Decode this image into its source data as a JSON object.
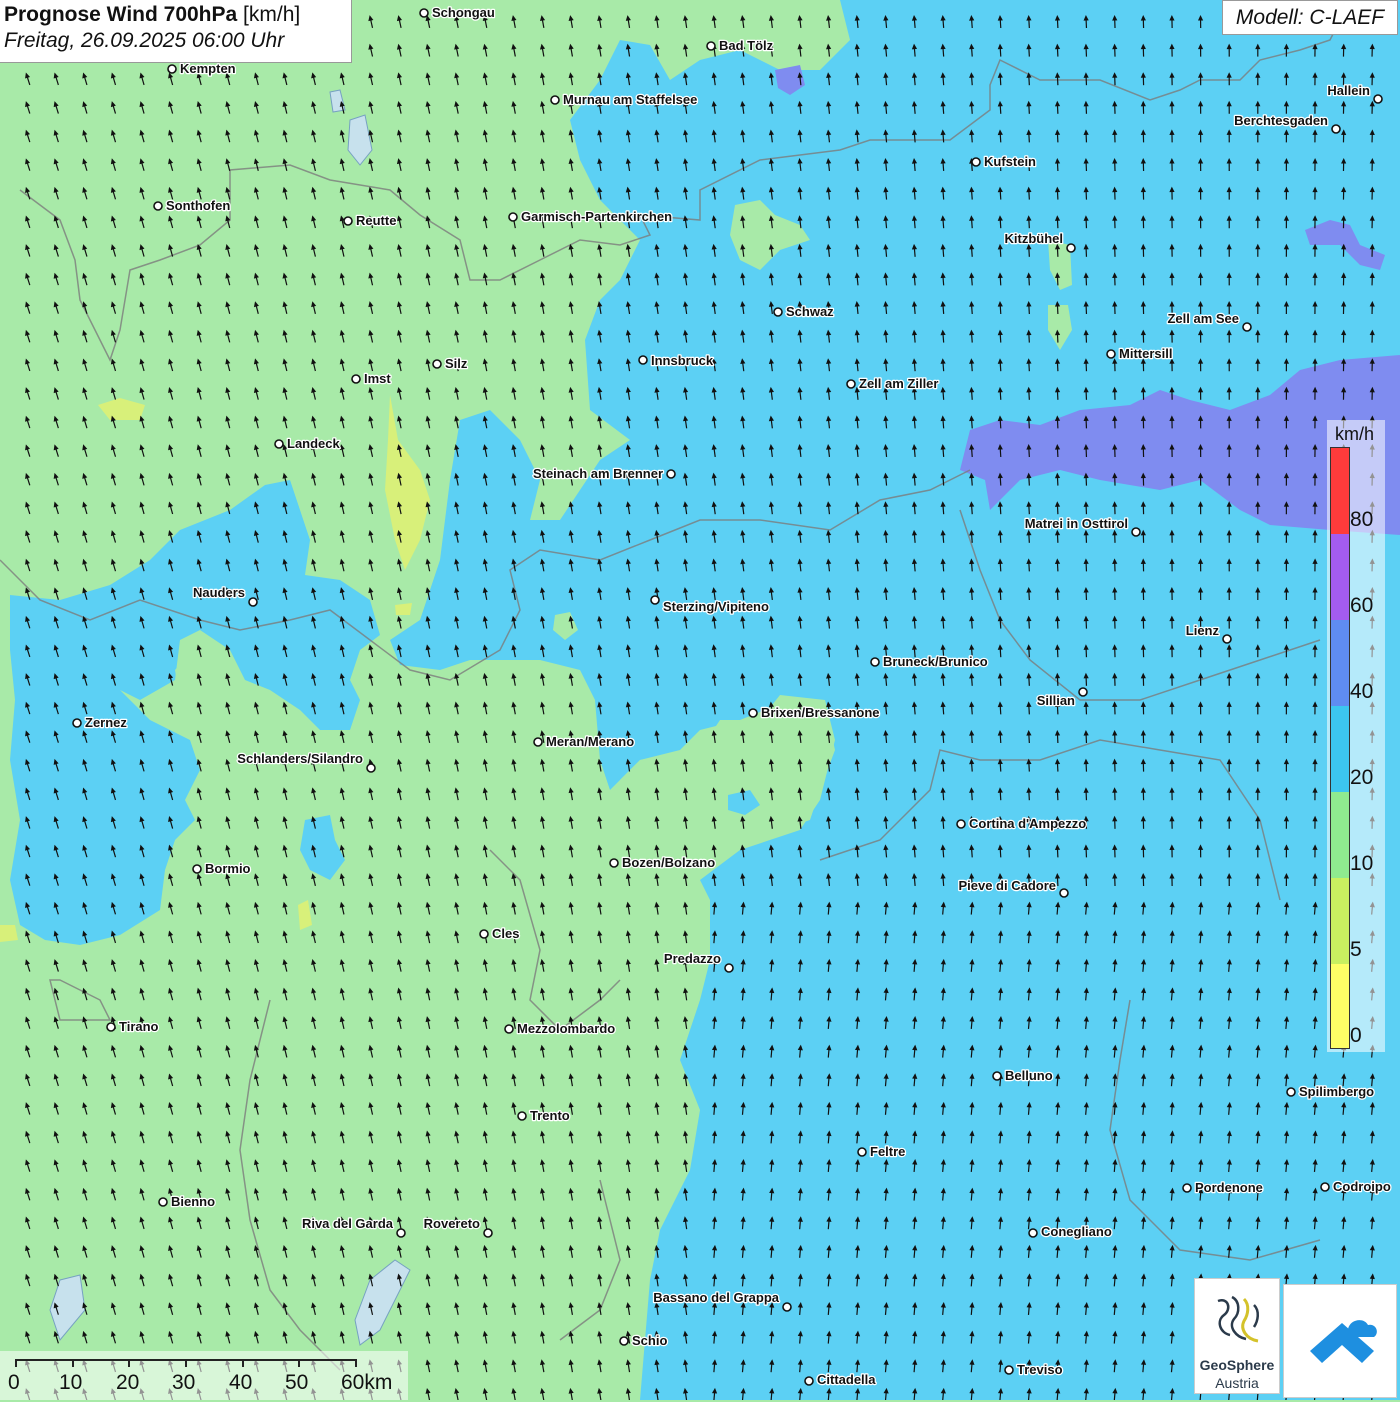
{
  "header": {
    "title_bold": "Prognose Wind 700hPa",
    "title_unit": "[km/h]",
    "datetime": "Freitag, 26.09.2025 06:00 Uhr"
  },
  "model": {
    "label": "Modell: C-LAEF"
  },
  "legend": {
    "unit": "km/h",
    "ticks": [
      "80",
      "60",
      "40",
      "20",
      "10",
      "5",
      "0"
    ],
    "colors": [
      "#ff3b3b",
      "#a45cf0",
      "#5f8cf2",
      "#3cc6f0",
      "#8fea8f",
      "#c9f060",
      "#ffff66"
    ]
  },
  "field_colors": {
    "light_green": "#a8eaa8",
    "blue": "#5cd0f4",
    "purple": "#7f8cf0",
    "yellow_green": "#d8f07a"
  },
  "cities": [
    {
      "name": "Schongau"
    },
    {
      "name": "Bad Tölz"
    },
    {
      "name": "Kempten"
    },
    {
      "name": "Murnau am Staffelsee"
    },
    {
      "name": "Hallein"
    },
    {
      "name": "Berchtesgaden"
    },
    {
      "name": "Kufstein"
    },
    {
      "name": "Sonthofen"
    },
    {
      "name": "Reutte"
    },
    {
      "name": "Garmisch-Partenkirchen"
    },
    {
      "name": "Kitzbühel"
    },
    {
      "name": "Schwaz"
    },
    {
      "name": "Zell am See"
    },
    {
      "name": "Mittersill"
    },
    {
      "name": "Innsbruck"
    },
    {
      "name": "Silz"
    },
    {
      "name": "Imst"
    },
    {
      "name": "Zell am Ziller"
    },
    {
      "name": "Landeck"
    },
    {
      "name": "Steinach am Brenner"
    },
    {
      "name": "Matrei in Osttirol"
    },
    {
      "name": "Nauders"
    },
    {
      "name": "Sterzing/Vipiteno"
    },
    {
      "name": "Lienz"
    },
    {
      "name": "Bruneck/Brunico"
    },
    {
      "name": "Sillian"
    },
    {
      "name": "Brixen/Bressanone"
    },
    {
      "name": "Zernez"
    },
    {
      "name": "Meran/Merano"
    },
    {
      "name": "Schlanders/Silandro"
    },
    {
      "name": "Cortina d'Ampezzo"
    },
    {
      "name": "Bozen/Bolzano"
    },
    {
      "name": "Bormio"
    },
    {
      "name": "Pieve di Cadore"
    },
    {
      "name": "Cles"
    },
    {
      "name": "Predazzo"
    },
    {
      "name": "Tirano"
    },
    {
      "name": "Mezzolombardo"
    },
    {
      "name": "Belluno"
    },
    {
      "name": "Spilimbergo"
    },
    {
      "name": "Trento"
    },
    {
      "name": "Feltre"
    },
    {
      "name": "Pordenone"
    },
    {
      "name": "Codroipo"
    },
    {
      "name": "Bienno"
    },
    {
      "name": "Riva del Garda"
    },
    {
      "name": "Rovereto"
    },
    {
      "name": "Conegliano"
    },
    {
      "name": "Bassano del Grappa"
    },
    {
      "name": "Schio"
    },
    {
      "name": "Treviso"
    },
    {
      "name": "Cittadella"
    }
  ],
  "scale": {
    "labels": [
      "0",
      "10",
      "20",
      "30",
      "40",
      "50",
      "60km"
    ]
  },
  "logos": {
    "geosphere_name": "GeoSphere",
    "geosphere_country": "Austria"
  }
}
